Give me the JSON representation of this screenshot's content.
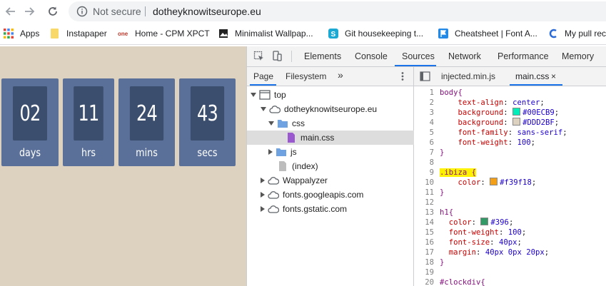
{
  "address_bar": {
    "security_text": "Not secure",
    "url": "dotheyknowitseurope.eu"
  },
  "bookmarks": [
    {
      "label": "Apps",
      "icon": "apps-grid-icon"
    },
    {
      "label": "Instapaper",
      "icon": "folder-icon"
    },
    {
      "label": "Home - CPM XPCT",
      "icon": "one-logo-icon"
    },
    {
      "label": "Minimalist Wallpap...",
      "icon": "image-icon"
    },
    {
      "label": "Git housekeeping t...",
      "icon": "s-logo-icon"
    },
    {
      "label": "Cheatsheet | Font A...",
      "icon": "flag-icon"
    },
    {
      "label": "My pull rec",
      "icon": "c-logo-icon"
    }
  ],
  "countdown": [
    {
      "value": "02",
      "unit": "days"
    },
    {
      "value": "11",
      "unit": "hrs"
    },
    {
      "value": "24",
      "unit": "mins"
    },
    {
      "value": "43",
      "unit": "secs"
    }
  ],
  "devtools": {
    "tabs": [
      "Elements",
      "Console",
      "Sources",
      "Network",
      "Performance",
      "Memory"
    ],
    "active_tab": "Sources",
    "navigator_tabs": [
      "Page",
      "Filesystem"
    ],
    "tree": {
      "top": "top",
      "domain": "dotheyknowitseurope.eu",
      "css_folder": "css",
      "css_file": "main.css",
      "js_folder": "js",
      "index": "(index)",
      "wappalyzer": "Wappalyzer",
      "googleapis": "fonts.googleapis.com",
      "gstatic": "fonts.gstatic.com"
    },
    "editor_tabs": [
      "injected.min.js",
      "main.css"
    ],
    "active_editor_tab": "main.css",
    "code": {
      "line_numbers": [
        "1",
        "2",
        "3",
        "4",
        "5",
        "6",
        "7",
        "8",
        "9",
        "10",
        "11",
        "12",
        "13",
        "14",
        "15",
        "16",
        "17",
        "18",
        "19",
        "20"
      ],
      "l1": "body{",
      "l2_prop": "text-align",
      "l2_val": "center",
      "l3_prop": "background",
      "l3_val": "#00ECB9",
      "l4_prop": "background",
      "l4_val": "#DDD2BF",
      "l5_prop": "font-family",
      "l5_val": "sans-serif",
      "l6_prop": "font-weight",
      "l6_val": "100",
      "l7": "}",
      "l9": ".ibiza {",
      "l10_prop": "color",
      "l10_val": "#f39f18",
      "l11": "}",
      "l13": "h1{",
      "l14_prop": "color",
      "l14_val": "#396",
      "l15_prop": "font-weight",
      "l15_val": "100",
      "l16_prop": "font-size",
      "l16_val": "40px",
      "l17_prop": "margin",
      "l17_val": "40px 0px 20px",
      "l18": "}",
      "l20": "#clockdiv{"
    }
  },
  "colors": {
    "page_background": "#DDD2BF",
    "tile": "#5A7099",
    "tile_digit": "#3B4E6E",
    "accent_blue": "#1A73E8",
    "swatch_teal": "#00ECB9",
    "swatch_beige": "#DDD2BF",
    "swatch_orange": "#F39F18",
    "swatch_green": "#339966"
  }
}
